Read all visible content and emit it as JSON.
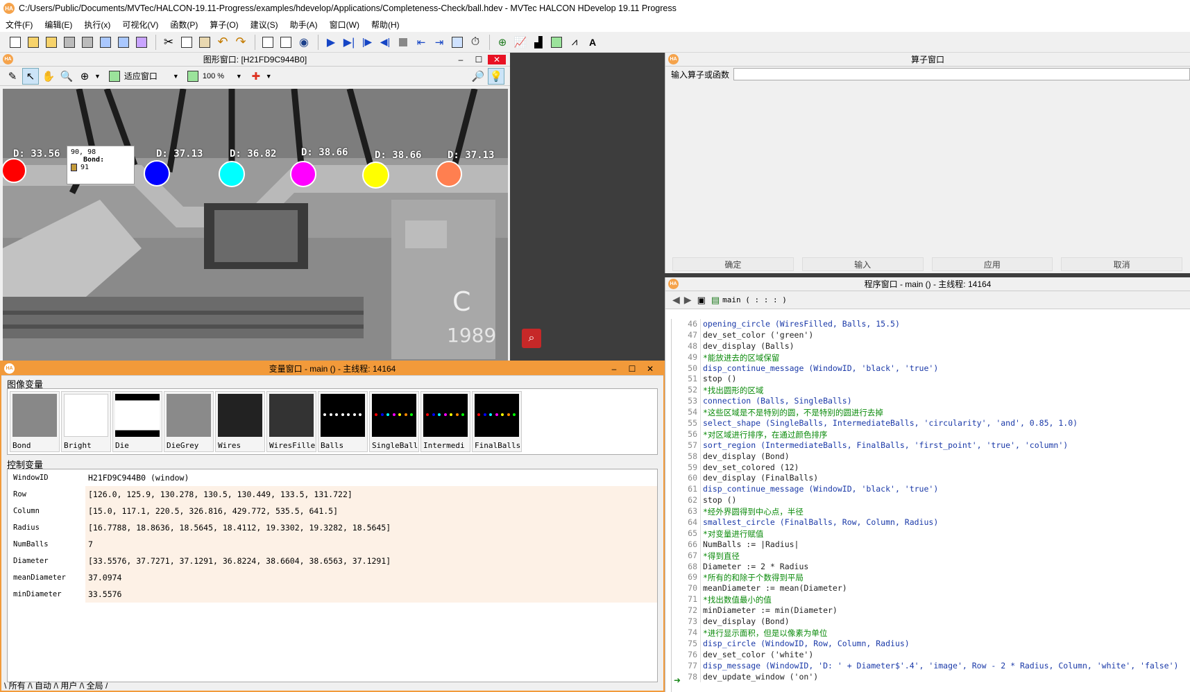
{
  "app": {
    "title": "C:/Users/Public/Documents/MVTec/HALCON-19.11-Progress/examples/hdevelop/Applications/Completeness-Check/ball.hdev - MVTec HALCON HDevelop 19.11 Progress"
  },
  "menu": [
    "文件(F)",
    "编辑(E)",
    "执行(x)",
    "可视化(V)",
    "函数(P)",
    "算子(O)",
    "建议(S)",
    "助手(A)",
    "窗口(W)",
    "帮助(H)"
  ],
  "graphics": {
    "title": "图形窗口: [H21FD9C944B0]",
    "fit_label": "适应窗口",
    "zoom": "100 %",
    "tooltip": {
      "coords": "90,  98",
      "name": "Bond:",
      "value": "91"
    },
    "balls": [
      {
        "label": "D: 33.56",
        "color": "#ff0000"
      },
      {
        "label": "D: 37.13",
        "color": "#0000ff"
      },
      {
        "label": "D: 36.82",
        "color": "#00ffff"
      },
      {
        "label": "D: 38.66",
        "color": "#ff00ff"
      },
      {
        "label": "D: 38.66",
        "color": "#ffff00"
      },
      {
        "label": "D: 37.13",
        "color": "#ff7f50"
      }
    ],
    "chip_marks": [
      "C",
      "1989"
    ]
  },
  "variables": {
    "title": "变量窗口 - main () - 主线程: 14164",
    "image_section": "图像变量",
    "control_section": "控制变量",
    "images": [
      "Bond",
      "Bright",
      "Die",
      "DieGrey",
      "Wires",
      "WiresFille",
      "Balls",
      "SingleBall",
      "Intermedi",
      "FinalBalls"
    ],
    "controls": [
      {
        "name": "WindowID",
        "value": "H21FD9C944B0 (window)"
      },
      {
        "name": "Row",
        "value": "[126.0, 125.9, 130.278, 130.5, 130.449, 133.5, 131.722]"
      },
      {
        "name": "Column",
        "value": "[15.0, 117.1, 220.5, 326.816, 429.772, 535.5, 641.5]"
      },
      {
        "name": "Radius",
        "value": "[16.7788, 18.8636, 18.5645, 18.4112, 19.3302, 19.3282, 18.5645]"
      },
      {
        "name": "NumBalls",
        "value": "7"
      },
      {
        "name": "Diameter",
        "value": "[33.5576, 37.7271, 37.1291, 36.8224, 38.6604, 38.6563, 37.1291]"
      },
      {
        "name": "meanDiameter",
        "value": "37.0974"
      },
      {
        "name": "minDiameter",
        "value": "33.5576"
      }
    ],
    "tabs": "\\ 所有 /\\ 自动 /\\ 用户 /\\ 全局 /"
  },
  "operator": {
    "title": "算子窗口",
    "input_label": "输入算子或函数",
    "buttons": [
      "确定",
      "输入",
      "应用",
      "取消"
    ]
  },
  "program": {
    "title": "程序窗口 - main () - 主线程: 14164",
    "procedure": "main ( : : : )",
    "lines": [
      {
        "n": "46",
        "t": "opening_circle (WiresFilled, Balls, 15.5)",
        "k": "op"
      },
      {
        "n": "47",
        "t": "dev_set_color ('green')",
        "k": "pl"
      },
      {
        "n": "48",
        "t": "dev_display (Balls)",
        "k": "pl"
      },
      {
        "n": "49",
        "t": "*能放进去的区域保留",
        "k": "cm"
      },
      {
        "n": "50",
        "t": "disp_continue_message (WindowID, 'black', 'true')",
        "k": "op"
      },
      {
        "n": "51",
        "t": "stop ()",
        "k": "pl"
      },
      {
        "n": "52",
        "t": "*找出圆形的区域",
        "k": "cm"
      },
      {
        "n": "53",
        "t": "connection (Balls, SingleBalls)",
        "k": "op"
      },
      {
        "n": "54",
        "t": "*这些区域是不是特别的圆，不是特别的圆进行去掉",
        "k": "cm"
      },
      {
        "n": "55",
        "t": "select_shape (SingleBalls, IntermediateBalls, 'circularity', 'and', 0.85, 1.0)",
        "k": "op"
      },
      {
        "n": "56",
        "t": "*对区域进行排序，在通过颜色排序",
        "k": "cm"
      },
      {
        "n": "57",
        "t": "sort_region (IntermediateBalls, FinalBalls, 'first_point', 'true', 'column')",
        "k": "op"
      },
      {
        "n": "58",
        "t": "dev_display (Bond)",
        "k": "pl"
      },
      {
        "n": "59",
        "t": "dev_set_colored (12)",
        "k": "pl"
      },
      {
        "n": "60",
        "t": "dev_display (FinalBalls)",
        "k": "pl"
      },
      {
        "n": "61",
        "t": "disp_continue_message (WindowID, 'black', 'true')",
        "k": "op"
      },
      {
        "n": "62",
        "t": "stop ()",
        "k": "pl"
      },
      {
        "n": "63",
        "t": "*经外界圆得到中心点，半径",
        "k": "cm"
      },
      {
        "n": "64",
        "t": "smallest_circle (FinalBalls, Row, Column, Radius)",
        "k": "op"
      },
      {
        "n": "65",
        "t": "*对变量进行赋值",
        "k": "cm"
      },
      {
        "n": "66",
        "t": "NumBalls := |Radius|",
        "k": "pl"
      },
      {
        "n": "67",
        "t": "*得到直径",
        "k": "cm"
      },
      {
        "n": "68",
        "t": "Diameter := 2 * Radius",
        "k": "pl"
      },
      {
        "n": "69",
        "t": "*所有的和除于个数得到平局",
        "k": "cm"
      },
      {
        "n": "70",
        "t": "meanDiameter := mean(Diameter)",
        "k": "pl"
      },
      {
        "n": "71",
        "t": "*找出数值最小的值",
        "k": "cm"
      },
      {
        "n": "72",
        "t": "minDiameter := min(Diameter)",
        "k": "pl"
      },
      {
        "n": "73",
        "t": "dev_display (Bond)",
        "k": "pl"
      },
      {
        "n": "74",
        "t": "*进行显示面积，但是以像素为单位",
        "k": "cm"
      },
      {
        "n": "75",
        "t": "disp_circle (WindowID, Row, Column, Radius)",
        "k": "op"
      },
      {
        "n": "76",
        "t": "dev_set_color ('white')",
        "k": "pl"
      },
      {
        "n": "77",
        "t": "disp_message (WindowID, 'D: ' + Diameter$'.4', 'image', Row - 2 * Radius, Column, 'white', 'false')",
        "k": "op"
      },
      {
        "n": "78",
        "t": "dev_update_window ('on')",
        "k": "pl"
      }
    ]
  }
}
